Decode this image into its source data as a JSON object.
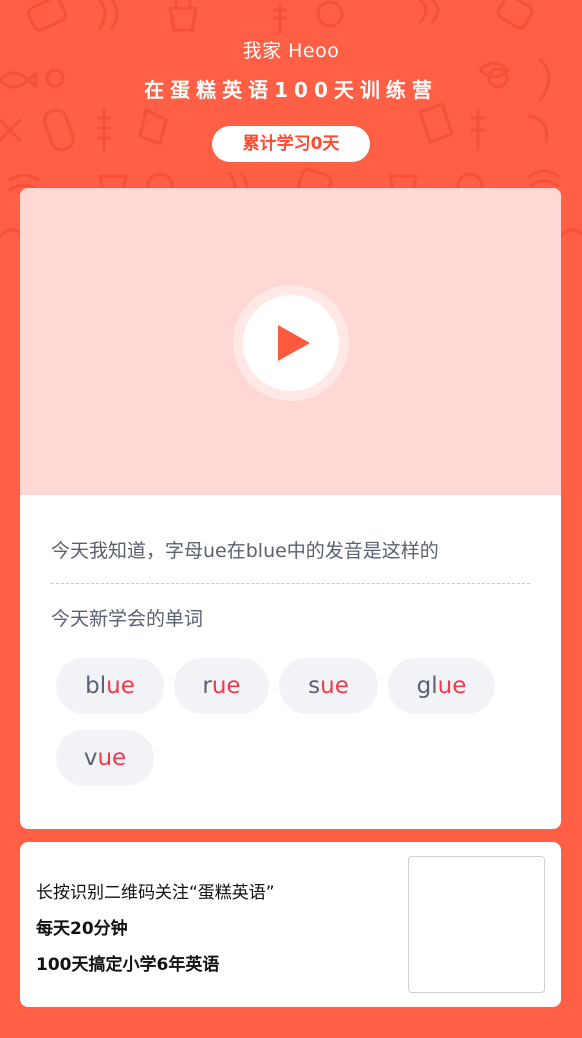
{
  "header": {
    "user_name": "我家 Heoo",
    "camp_title": "在蛋糕英语100天训练营",
    "days_badge": "累计学习0天"
  },
  "lesson": {
    "description": "今天我知道，字母ue在blue中的发音是这样的",
    "new_words_title": "今天新学会的单词",
    "words": [
      {
        "prefix": "bl",
        "highlight": "ue"
      },
      {
        "prefix": "r",
        "highlight": "ue"
      },
      {
        "prefix": "s",
        "highlight": "ue"
      },
      {
        "prefix": "gl",
        "highlight": "ue"
      },
      {
        "prefix": "v",
        "highlight": "ue"
      }
    ]
  },
  "footer": {
    "line1": "长按识别二维码关注“蛋糕英语”",
    "line2": "每天20分钟",
    "line3": "100天搞定小学6年英语"
  },
  "colors": {
    "background": "#ff5f45",
    "video_bg": "#ffd7d5",
    "play_icon": "#ff5a3e",
    "highlight": "#f2394a",
    "text_gray": "#5a6171"
  },
  "icons": {
    "play": "play-icon",
    "background_pattern": "food-pattern"
  }
}
